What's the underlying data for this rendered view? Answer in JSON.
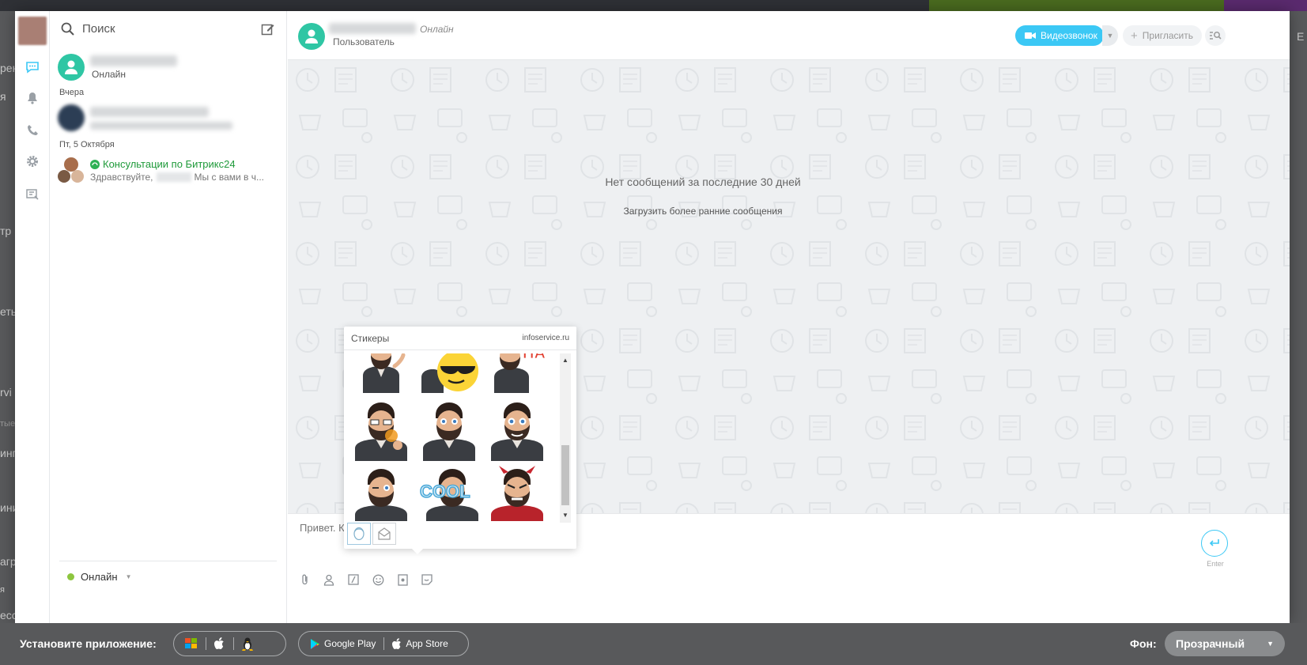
{
  "nav": {
    "icons": [
      "chat-icon",
      "bell-icon",
      "phone-icon",
      "gear-icon",
      "notes-icon"
    ]
  },
  "list": {
    "search_placeholder": "Поиск",
    "current_user_status": "Онлайн",
    "sep_yesterday": "Вчера",
    "sep_friday": "Пт, 5 Октября",
    "chat_consult_title": "Консультации по Битрикс24",
    "chat_consult_preview_a": "Здравствуйте,",
    "chat_consult_preview_b": "Мы с вами в ч...",
    "my_status": "Онлайн"
  },
  "header": {
    "status": "Онлайн",
    "role": "Пользователь",
    "video_label": "Видеозвонок",
    "invite_label": "Пригласить"
  },
  "body": {
    "no_messages": "Нет сообщений за последние 30 дней",
    "load_earlier": "Загрузить более ранние сообщения"
  },
  "input": {
    "placeholder": "Привет. Как и",
    "enter_hint": "Enter"
  },
  "stickers": {
    "title": "Стикеры",
    "source": "infoservice.ru",
    "cool_text": "COOL",
    "ha_text": "HA"
  },
  "bottom": {
    "install_label": "Установите приложение:",
    "google_play": "Google Play",
    "app_store": "App Store",
    "bg_label": "Фон:",
    "bg_value": "Прозрачный"
  },
  "background_fragments": {
    "frag1": "рен",
    "frag2": "я",
    "frag3": "тр",
    "frag4": "еть",
    "frag5": "rvi",
    "frag6": "тые",
    "frag7": "инг",
    "frag8": "ини",
    "frag9": "агр",
    "frag10": "я",
    "frag11": "ессы",
    "frag12": "E"
  },
  "colors": {
    "accent": "#3bc8f5",
    "online": "#8dc63f",
    "green_link": "#1f9a3a",
    "avatar": "#2fc6a4"
  }
}
